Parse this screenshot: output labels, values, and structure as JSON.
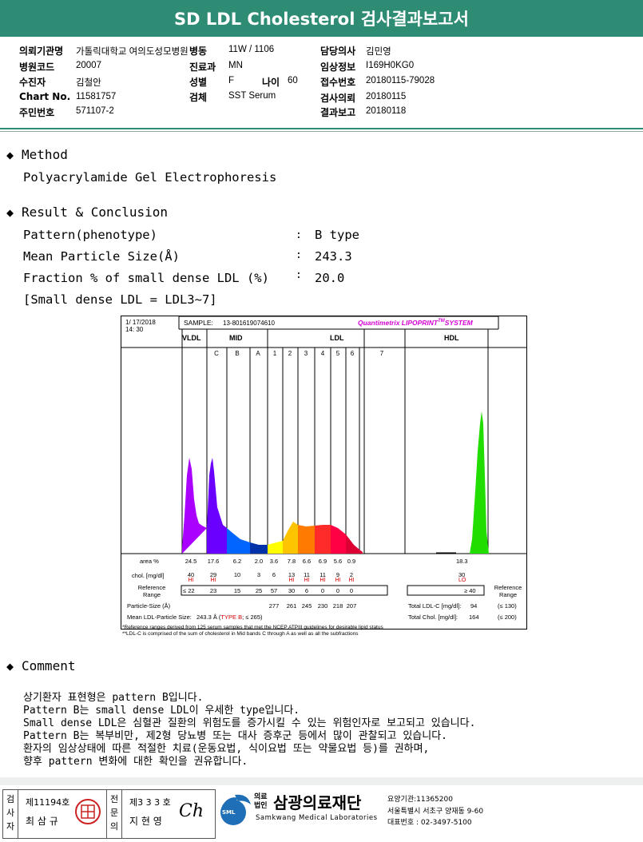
{
  "header": {
    "title": "SD LDL Cholesterol 검사결과보고서"
  },
  "info": {
    "col1": [
      {
        "label": "의뢰기관명",
        "value": "가톨릭대학교 여의도성모병원"
      },
      {
        "label": "병원코드",
        "value": "20007"
      },
      {
        "label": "수진자",
        "value": "김철안"
      },
      {
        "label": "Chart No.",
        "value": "11581757"
      },
      {
        "label": "주민번호",
        "value": "571107-2"
      }
    ],
    "col2": [
      {
        "label": "병동",
        "value": "11W / 1106"
      },
      {
        "label": "진료과",
        "value": "MN"
      },
      {
        "label": "성별",
        "value": "F"
      },
      {
        "label": "검체",
        "value": "SST Serum"
      }
    ],
    "age": {
      "label": "나이",
      "value": "60"
    },
    "col3": [
      {
        "label": "담당의사",
        "value": "김민영"
      },
      {
        "label": "임상정보",
        "value": "I169H0KG0"
      },
      {
        "label": "접수번호",
        "value": "20180115-79028"
      },
      {
        "label": "검사의뢰",
        "value": "20180115"
      },
      {
        "label": "결과보고",
        "value": "20180118"
      }
    ]
  },
  "method": {
    "title": "Method",
    "text": "Polyacrylamide Gel Electrophoresis"
  },
  "result": {
    "title": "Result & Conclusion",
    "rows": [
      {
        "label": "Pattern(phenotype)",
        "value": "B type"
      },
      {
        "label": "Mean Particle Size(Å)",
        "value": "243.3"
      },
      {
        "label": "Fraction % of small dense LDL (%)",
        "value": "20.0"
      }
    ],
    "note": "[Small dense LDL = LDL3~7]"
  },
  "lipoprint": {
    "date": "1/ 17/2018",
    "time": "14: 30",
    "sample_label": "SAMPLE:",
    "sample_id": "13-801619074610",
    "brand": "Quantimetrix LIPOPRINT",
    "brand_tm": "TM",
    "brand_sys": "SYSTEM",
    "brand_color": "#d400d4",
    "band_groups": [
      "VLDL",
      "MID",
      "LDL",
      "HDL"
    ],
    "sub_bands": [
      "C",
      "B",
      "A",
      "1",
      "2",
      "3",
      "4",
      "5",
      "6",
      "7"
    ],
    "table": {
      "area_label": "area %",
      "area": [
        "24.5",
        "17.6",
        "6.2",
        "2.0",
        "3.6",
        "7.8",
        "6.6",
        "6.9",
        "5.6",
        "0.9"
      ],
      "area_hdl": "18.3",
      "chol_label": "chol. [mg/dl]",
      "chol": [
        "40",
        "29",
        "10",
        "3",
        "6",
        "13",
        "11",
        "11",
        "9",
        "2"
      ],
      "chol_hdl": "30",
      "flags": [
        "HI",
        "HI",
        "",
        "",
        "",
        "HI",
        "HI",
        "HI",
        "HI",
        "HI"
      ],
      "flag_hdl": "LO",
      "ref_label": "Reference Range",
      "ref_first": "≤  22",
      "ref": [
        "23",
        "15",
        "25",
        "57",
        "30",
        "6",
        "0",
        "0",
        "0"
      ],
      "ref_hdl": "≥ 40",
      "ref_label_right": "Reference Range",
      "particle_label": "Particle-Size (Å)",
      "particle": [
        "277",
        "261",
        "245",
        "230",
        "218",
        "207"
      ],
      "mean_label": "Mean LDL-Particle Size:",
      "mean_value": "243.3 Å",
      "mean_type": "TYPE B",
      "mean_ref": "; ≤ 265)",
      "total_ldl_label": "Total LDL-C [mg/dl]:",
      "total_ldl": "94",
      "total_ldl_ref": "(≤ 130)",
      "total_chol_label": "Total Chol. [mg/dl]:",
      "total_chol": "164",
      "total_chol_ref": "(≤ 200)"
    },
    "footnote1": "*Reference ranges derived from 125 serum samples that met the NCEP ATPIII guidelines for desirable lipid status",
    "footnote2": "**LDL-C is comprised of the sum of cholesterol in Mid bands C through A as well as all the subfractions"
  },
  "comment": {
    "title": "Comment",
    "lines": [
      "상기환자 표현형은 pattern B입니다.",
      "Pattern B는 small dense LDL이 우세한 type입니다.",
      "Small dense LDL은 심혈관 질환의 위험도를 증가시킬 수 있는 위험인자로 보고되고 있습니다.",
      "Pattern B는 복부비만, 제2형 당뇨병 또는 대사 증후군 등에서 많이 관찰되고 있습니다.",
      "환자의 임상상태에 따른 적절한 치료(운동요법, 식이요법 또는 약물요법 등)를 권하며,",
      "향후 pattern 변화에 대한 확인을 권유합니다."
    ]
  },
  "footer": {
    "tester_label": "검사자",
    "tester_no": "제11194호",
    "tester_name": "최 삼 규",
    "doctor_label": "전문의",
    "doctor_no": "제3 3 3 호",
    "doctor_name": "지 현 영",
    "doctor_sig": "Ch",
    "org_type": "의료법인",
    "org_name": "삼광의료재단",
    "org_en": "Samkwang Medical Laboratories",
    "logo_text": "SML",
    "code_line": "요양기관:11365200",
    "address": "서울특별시 서초구 양재동 9-60",
    "phone": "대표번호 : 02-3497-5100"
  }
}
